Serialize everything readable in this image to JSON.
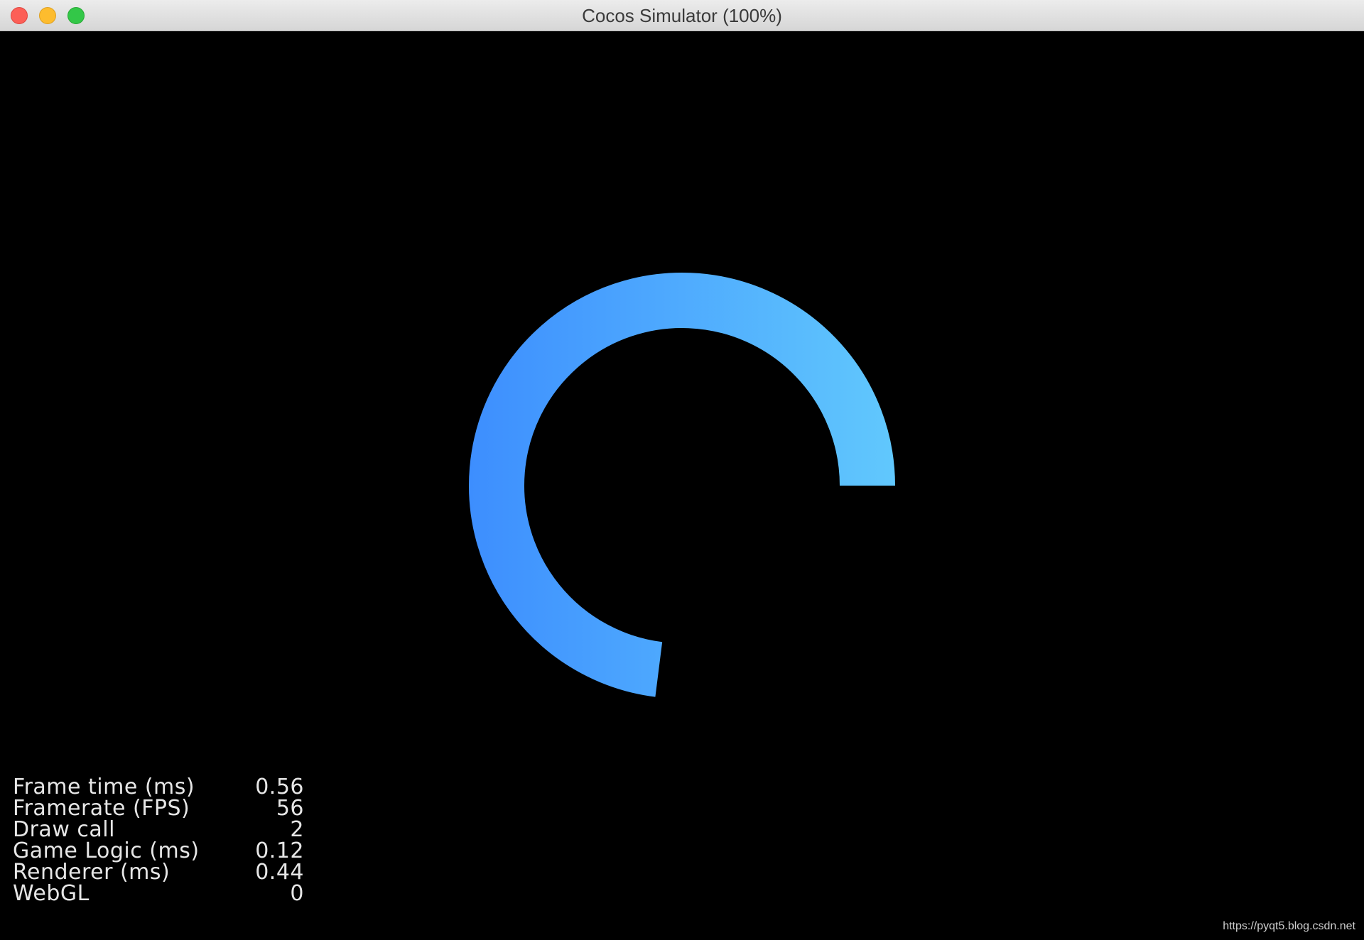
{
  "window": {
    "title": "Cocos Simulator (100%)"
  },
  "progress_ring": {
    "progress_fraction": 0.73,
    "color_start": "#3D8EFE",
    "color_end": "#61C8FD"
  },
  "stats": [
    {
      "label": "Frame time (ms)",
      "value": "0.56"
    },
    {
      "label": "Framerate (FPS)",
      "value": "56"
    },
    {
      "label": "Draw call",
      "value": "2"
    },
    {
      "label": "Game Logic (ms)",
      "value": "0.12"
    },
    {
      "label": "Renderer (ms)",
      "value": "0.44"
    },
    {
      "label": "WebGL",
      "value": "0"
    }
  ],
  "watermark": "https://pyqt5.blog.csdn.net"
}
